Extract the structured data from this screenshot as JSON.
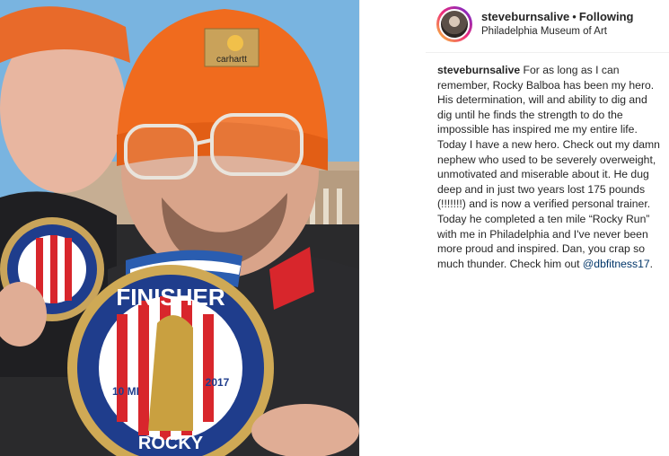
{
  "post": {
    "username": "steveburnsalive",
    "separator": "•",
    "follow_status": "Following",
    "location": "Philadelphia Museum of Art",
    "caption_text": "For as long as I can remember, Rocky Balboa has been my hero. His determination, will and ability to dig and dig until he finds the strength to do the impossible has inspired me my entire life. Today I have a new hero. Check out my damn nephew who used to be severely overweight, unmotivated and miserable about it. He dug deep and in just two years lost 175 pounds (!!!!!!!) and is now a verified personal trainer. Today he completed a ten mile “Rocky Run” with me in Philadelphia and I've never been more proud and inspired. Dan, you crap so much thunder. Check him out",
    "mention": "@dbfitness17",
    "caption_end": "."
  },
  "photo": {
    "hat_brand": "carhartt",
    "medal_top": "FINISHER",
    "medal_distance": "10 MI",
    "medal_year": "2017",
    "medal_bottom": "ROCKY"
  },
  "icons": {
    "next": "chevron-right-icon",
    "avatar": "profile-avatar"
  },
  "colors": {
    "text": "#262626",
    "mention": "#003569",
    "beanie": "#f06b1e"
  }
}
